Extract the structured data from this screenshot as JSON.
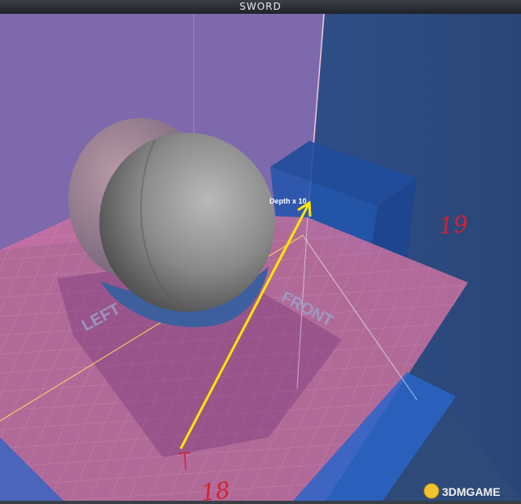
{
  "window": {
    "title": "SWORD"
  },
  "scene": {
    "labels": {
      "left": "LEFT",
      "front": "FRONT"
    },
    "measure": {
      "label": "Depth x 10"
    },
    "handwritten": {
      "near": "18",
      "far": "19"
    },
    "watermark": {
      "text": "3DMGAME"
    },
    "colors": {
      "background": "#2d4a78",
      "floor": "#c9709d",
      "left_wall": "#8d6fb6",
      "sphere": "#8a8a8a",
      "arrow": "#ffe600",
      "ink": "#d8202e"
    }
  }
}
